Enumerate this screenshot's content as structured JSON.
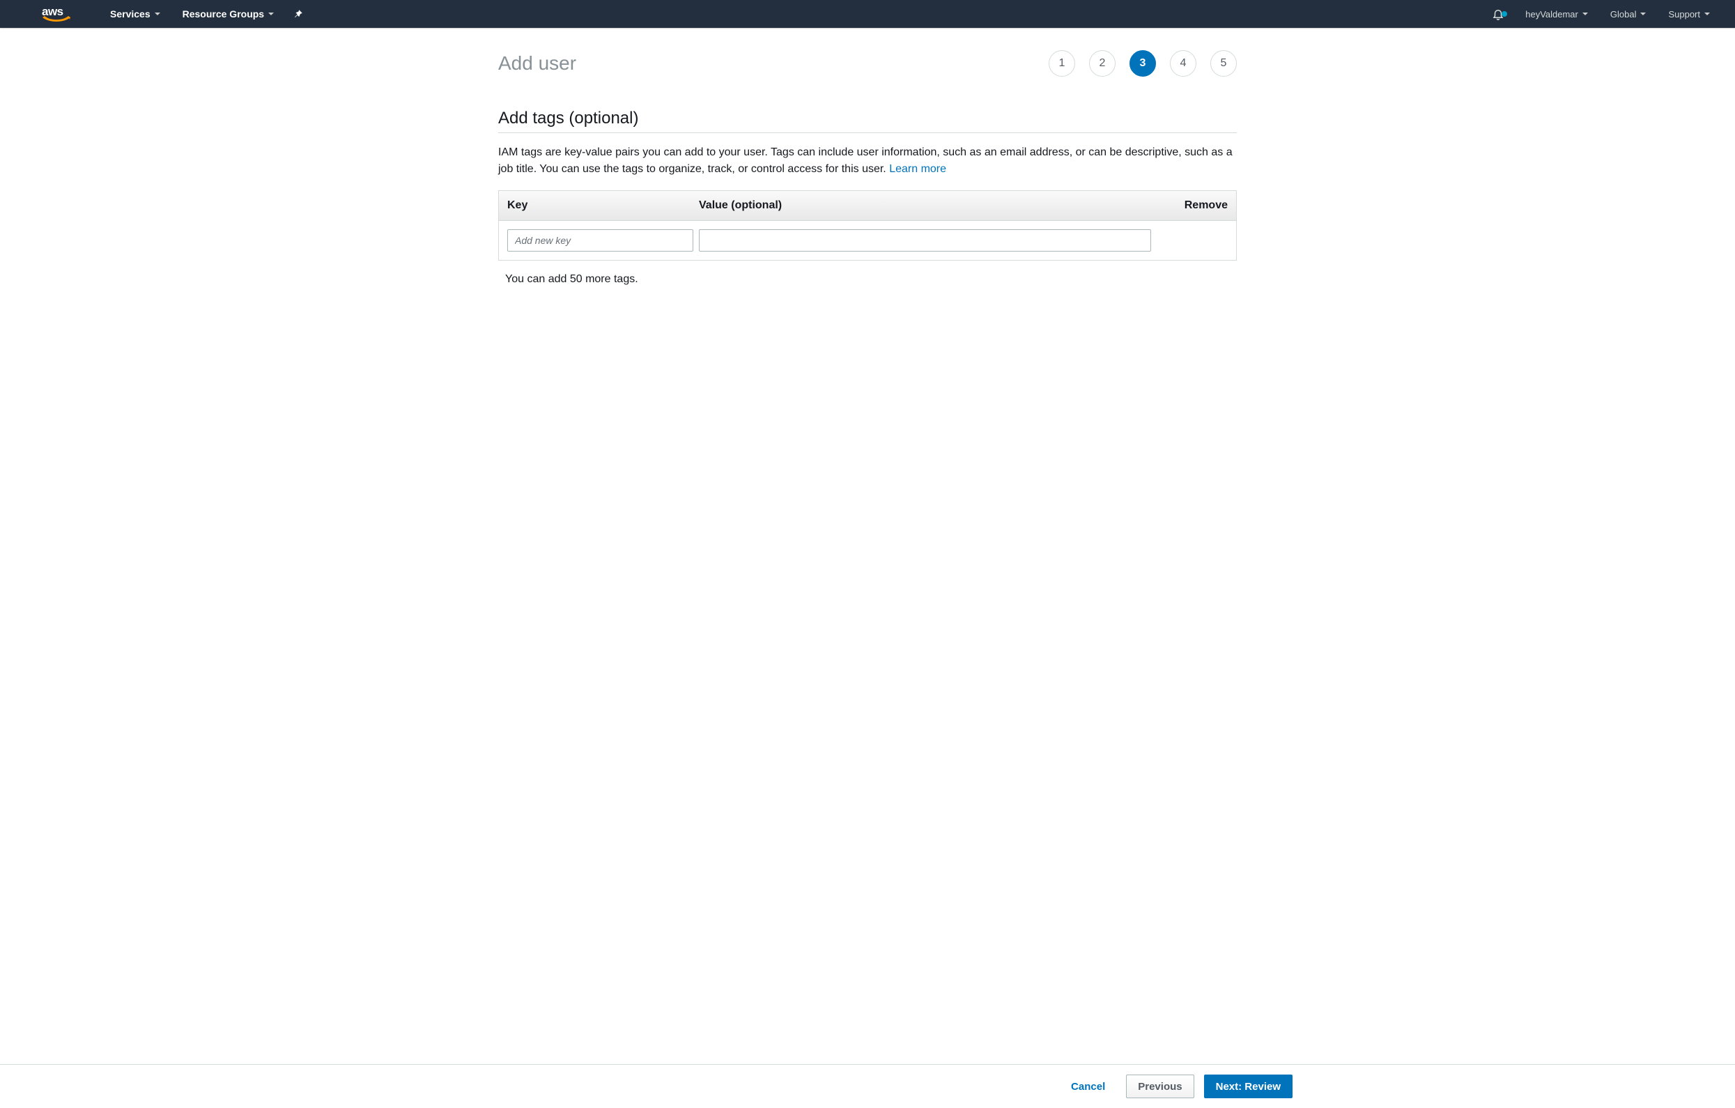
{
  "nav": {
    "services": "Services",
    "resource_groups": "Resource Groups",
    "account": "heyValdemar",
    "region": "Global",
    "support": "Support"
  },
  "page": {
    "title": "Add user",
    "steps": [
      "1",
      "2",
      "3",
      "4",
      "5"
    ],
    "active_step_index": 2,
    "section_title": "Add tags (optional)",
    "description_text": "IAM tags are key-value pairs you can add to your user. Tags can include user information, such as an email address, or can be descriptive, such as a job title. You can use the tags to organize, track, or control access for this user. ",
    "learn_more": "Learn more",
    "columns": {
      "key": "Key",
      "value": "Value (optional)",
      "remove": "Remove"
    },
    "key_placeholder": "Add new key",
    "tags_left": "You can add 50 more tags."
  },
  "footer": {
    "cancel": "Cancel",
    "previous": "Previous",
    "next": "Next: Review"
  }
}
